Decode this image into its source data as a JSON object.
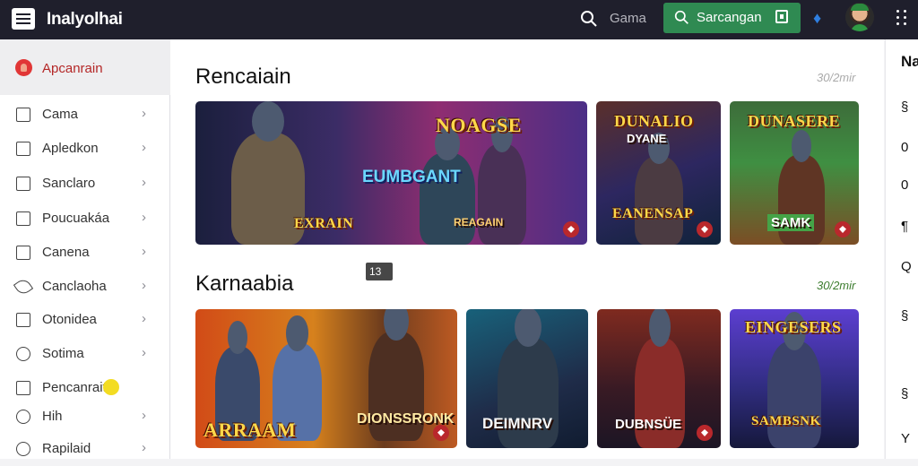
{
  "app": {
    "title": "Inalyolhai"
  },
  "header": {
    "search_label": "Gama",
    "primary_button_label": "Sarcangan",
    "icons": [
      "menu-icon",
      "search-icon",
      "flame-icon",
      "avatar",
      "more-icon"
    ]
  },
  "sidebar": {
    "active_label": "Apcanrain",
    "items": [
      {
        "label": "Cama",
        "icon": "square-icon"
      },
      {
        "label": "Apledkon",
        "icon": "square-icon"
      },
      {
        "label": "Sanclaro",
        "icon": "square-icon"
      },
      {
        "label": "Poucuakáa",
        "icon": "square-icon"
      },
      {
        "label": "Canena",
        "icon": "square-icon"
      },
      {
        "label": "Canclaoha",
        "icon": "leaf-icon"
      },
      {
        "label": "Otonidea",
        "icon": "square-icon"
      },
      {
        "label": "Sotima",
        "icon": "circle-icon"
      },
      {
        "label": "Pencanrait",
        "icon": "square-icon"
      },
      {
        "label": "Hih",
        "icon": "circle-icon"
      },
      {
        "label": "Rapilaid",
        "icon": "circle-icon"
      }
    ]
  },
  "main": {
    "sections": [
      {
        "title": "Rencaiain",
        "meta": "30/2mir",
        "cards": [
          {
            "title": "NOAGSE",
            "subtitle": "EUMBGANT",
            "footer": "EXRAIN",
            "subfooter": "REAGAIN",
            "badge": "13"
          },
          {
            "title": "DUNALIO",
            "subtitle": "DYANE",
            "footer": "EANENSAP"
          },
          {
            "title": "DUNASERE",
            "subtitle": "SAMK"
          }
        ]
      },
      {
        "title": "Karnaabia",
        "meta": "30/2mir",
        "cards": [
          {
            "title": "ARRAAM"
          },
          {
            "title": "DIONSSRONK"
          },
          {
            "title": "DEIMNRV"
          },
          {
            "title": "DUBNSÜE"
          },
          {
            "title": "EINGESERS",
            "subtitle": "SAMBSNK"
          }
        ]
      }
    ]
  },
  "right_panel": {
    "lines": [
      "Na",
      "§",
      "0",
      "0",
      "¶",
      "Q",
      "§",
      "§",
      "Y"
    ]
  },
  "colors": {
    "topbar": "#1f1f2c",
    "accent_green": "#2f8a52",
    "sidebar_active_red": "#b42727",
    "notification_yellow": "#f3dc22"
  }
}
